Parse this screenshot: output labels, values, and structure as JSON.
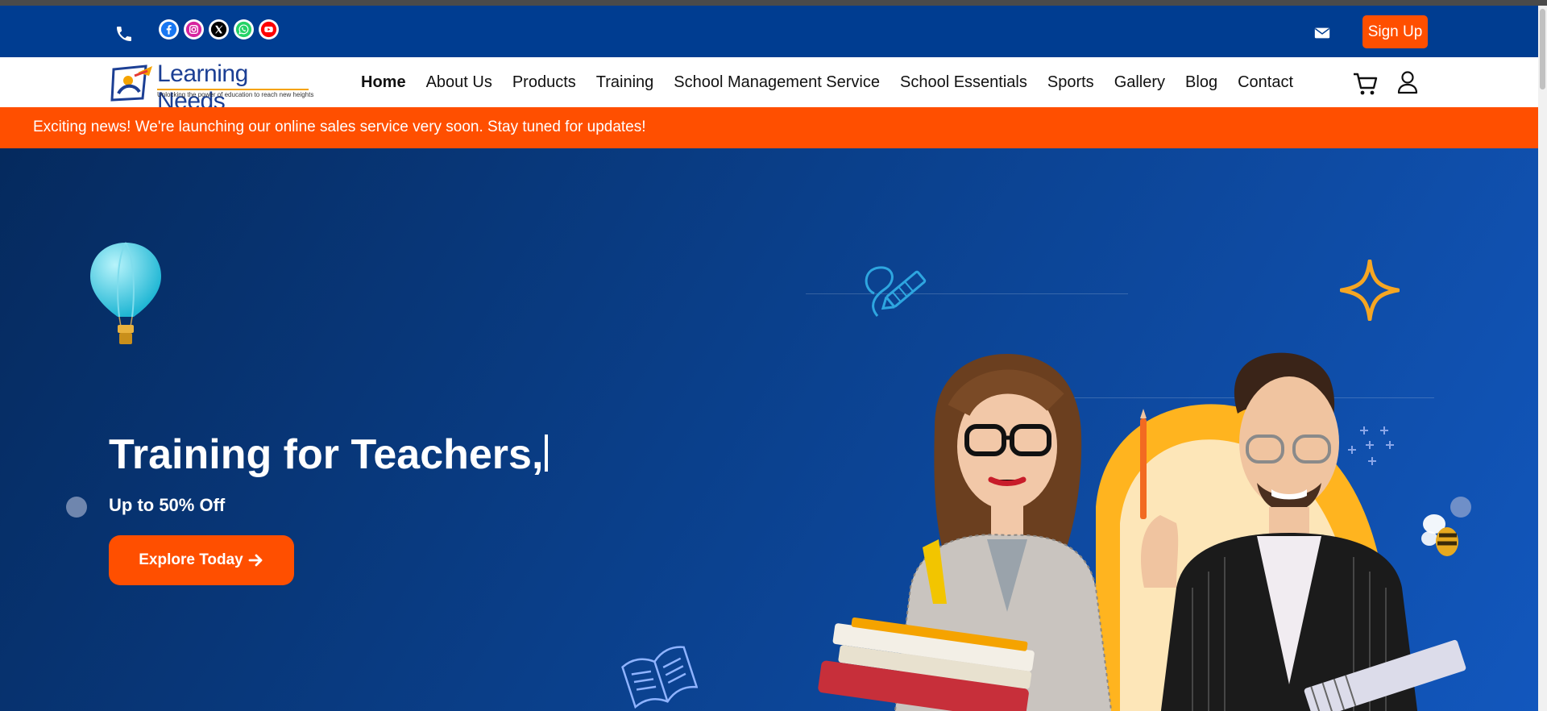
{
  "topbar": {
    "socials": [
      "facebook-icon",
      "instagram-icon",
      "x-icon",
      "whatsapp-icon",
      "youtube-icon"
    ],
    "signup_label": "Sign Up"
  },
  "brand": {
    "name": "Learning Needs",
    "tagline": "Unlocking the power of education to reach new heights"
  },
  "nav": {
    "items": [
      "Home",
      "About Us",
      "Products",
      "Training",
      "School Management Service",
      "School Essentials",
      "Sports",
      "Gallery",
      "Blog",
      "Contact"
    ],
    "active": "Home"
  },
  "announcement": {
    "text": "Exciting news! We're launching our online sales service very soon. Stay tuned for updates!"
  },
  "hero": {
    "title": "Training for Teachers,",
    "subtitle": "Up to 50% Off",
    "cta_label": "Explore Today"
  },
  "colors": {
    "topbar": "#003d91",
    "accent": "#ff4f00",
    "hero_start": "#052a5e",
    "hero_end": "#1257bd"
  }
}
